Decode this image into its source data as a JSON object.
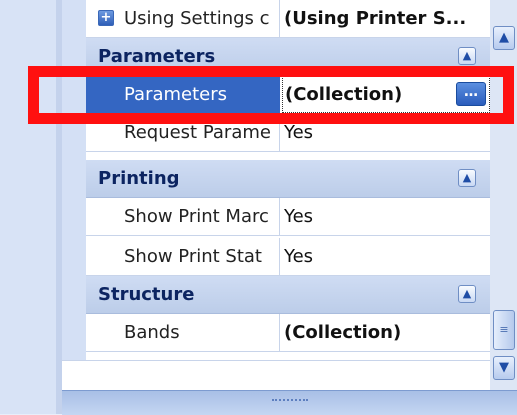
{
  "properties": {
    "top_row": {
      "name": "Using Settings c",
      "value": "(Using Printer S..."
    },
    "categories": [
      {
        "label": "Parameters",
        "collapse_icon": "chevron-up-icon"
      },
      {
        "label": "Printing",
        "collapse_icon": "chevron-up-icon"
      },
      {
        "label": "Structure",
        "collapse_icon": "chevron-up-icon"
      }
    ],
    "rows": [
      {
        "name": "Parameters",
        "value": "(Collection)",
        "button": "…"
      },
      {
        "name": "Request Parame",
        "value": "Yes"
      },
      {
        "name": "Show Print Marc",
        "value": "Yes"
      },
      {
        "name": "Show Print Stat",
        "value": "Yes"
      },
      {
        "name": "Bands",
        "value": "(Collection)"
      }
    ]
  },
  "colors": {
    "selection": "#3466c2",
    "annotation": "#ff1010",
    "category_text": "#0c2461"
  }
}
